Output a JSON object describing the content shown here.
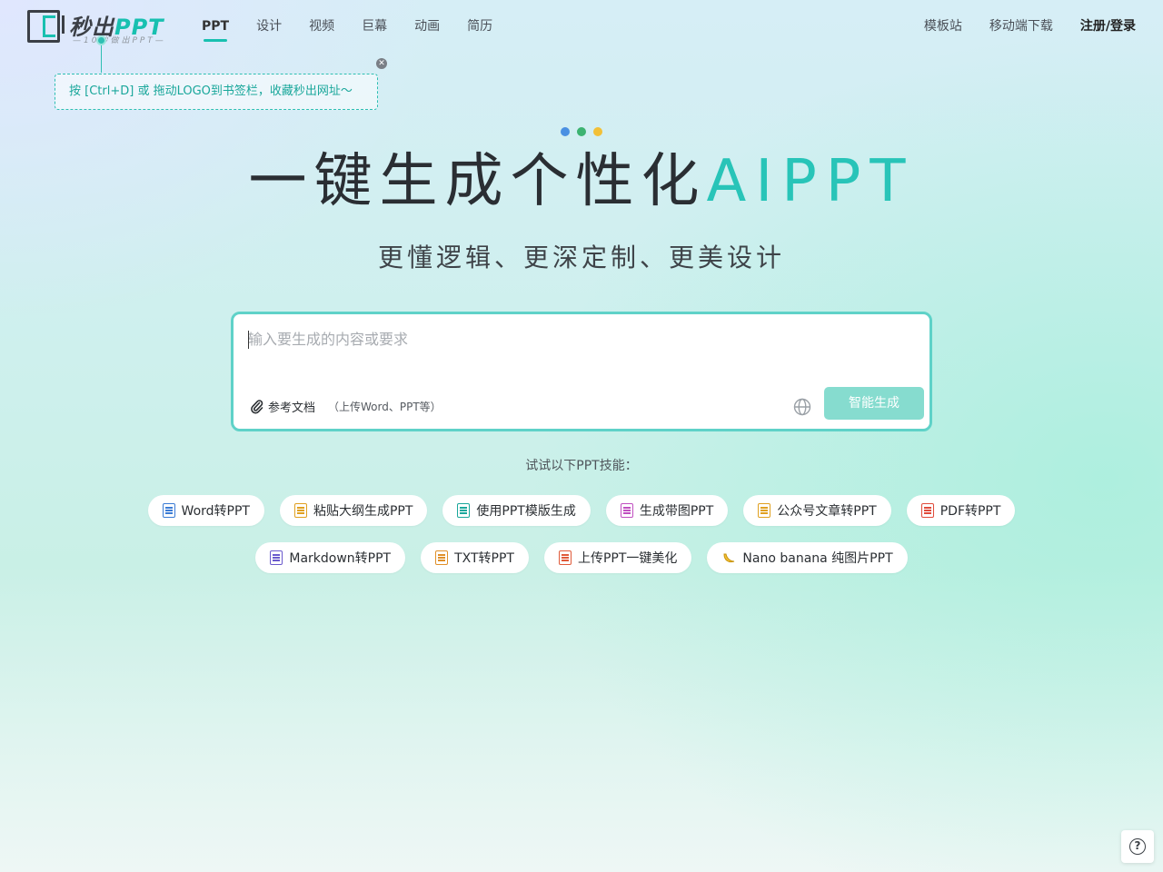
{
  "brand": {
    "name_prefix": "秒出",
    "name_suffix": "PPT",
    "tagline": "—10秒做出PPT—",
    "accent_color": "#18c0b0"
  },
  "nav": {
    "items": [
      {
        "label": "PPT",
        "active": true
      },
      {
        "label": "设计"
      },
      {
        "label": "视频"
      },
      {
        "label": "巨幕"
      },
      {
        "label": "动画"
      },
      {
        "label": "简历"
      }
    ]
  },
  "header_right": {
    "templates": "模板站",
    "mobile_download": "移动端下载",
    "login": "注册/登录"
  },
  "bookmark_tip": {
    "text": "按 [Ctrl+D] 或 拖动LOGO到书签栏，收藏秒出网址～",
    "close_icon": "close-icon"
  },
  "hero": {
    "dot_colors": [
      "#4a90e2",
      "#3cb371",
      "#f2c037"
    ],
    "title_main": "一键生成个性化",
    "title_accent": "AIPPT",
    "subtitle": "更懂逻辑、更深定制、更美设计"
  },
  "composer": {
    "placeholder": "输入要生成的内容或要求",
    "attach_label": "参考文档",
    "attach_hint": "（上传Word、PPT等）",
    "generate_label": "智能生成",
    "button_color": "#86dccf"
  },
  "skills": {
    "label": "试试以下PPT技能：",
    "row1": [
      {
        "label": "Word转PPT",
        "icon": "word-doc-icon",
        "color": "#3a7bd5"
      },
      {
        "label": "粘贴大纲生成PPT",
        "icon": "outline-doc-icon",
        "color": "#e0a020"
      },
      {
        "label": "使用PPT模版生成",
        "icon": "template-icon",
        "color": "#1aa79b"
      },
      {
        "label": "生成带图PPT",
        "icon": "image-doc-icon",
        "color": "#c04fc0"
      },
      {
        "label": "公众号文章转PPT",
        "icon": "article-doc-icon",
        "color": "#e0a020"
      },
      {
        "label": "PDF转PPT",
        "icon": "pdf-doc-icon",
        "color": "#e04a3a"
      }
    ],
    "row2": [
      {
        "label": "Markdown转PPT",
        "icon": "markdown-doc-icon",
        "color": "#6a5acd"
      },
      {
        "label": "TXT转PPT",
        "icon": "txt-doc-icon",
        "color": "#e0902a"
      },
      {
        "label": "上传PPT一键美化",
        "icon": "ppt-doc-icon",
        "color": "#e05a3a"
      },
      {
        "label": "Nano banana 纯图片PPT",
        "icon": "banana-icon",
        "color": "#f2b705"
      }
    ]
  },
  "help": {
    "icon": "help-icon",
    "glyph": "?"
  }
}
